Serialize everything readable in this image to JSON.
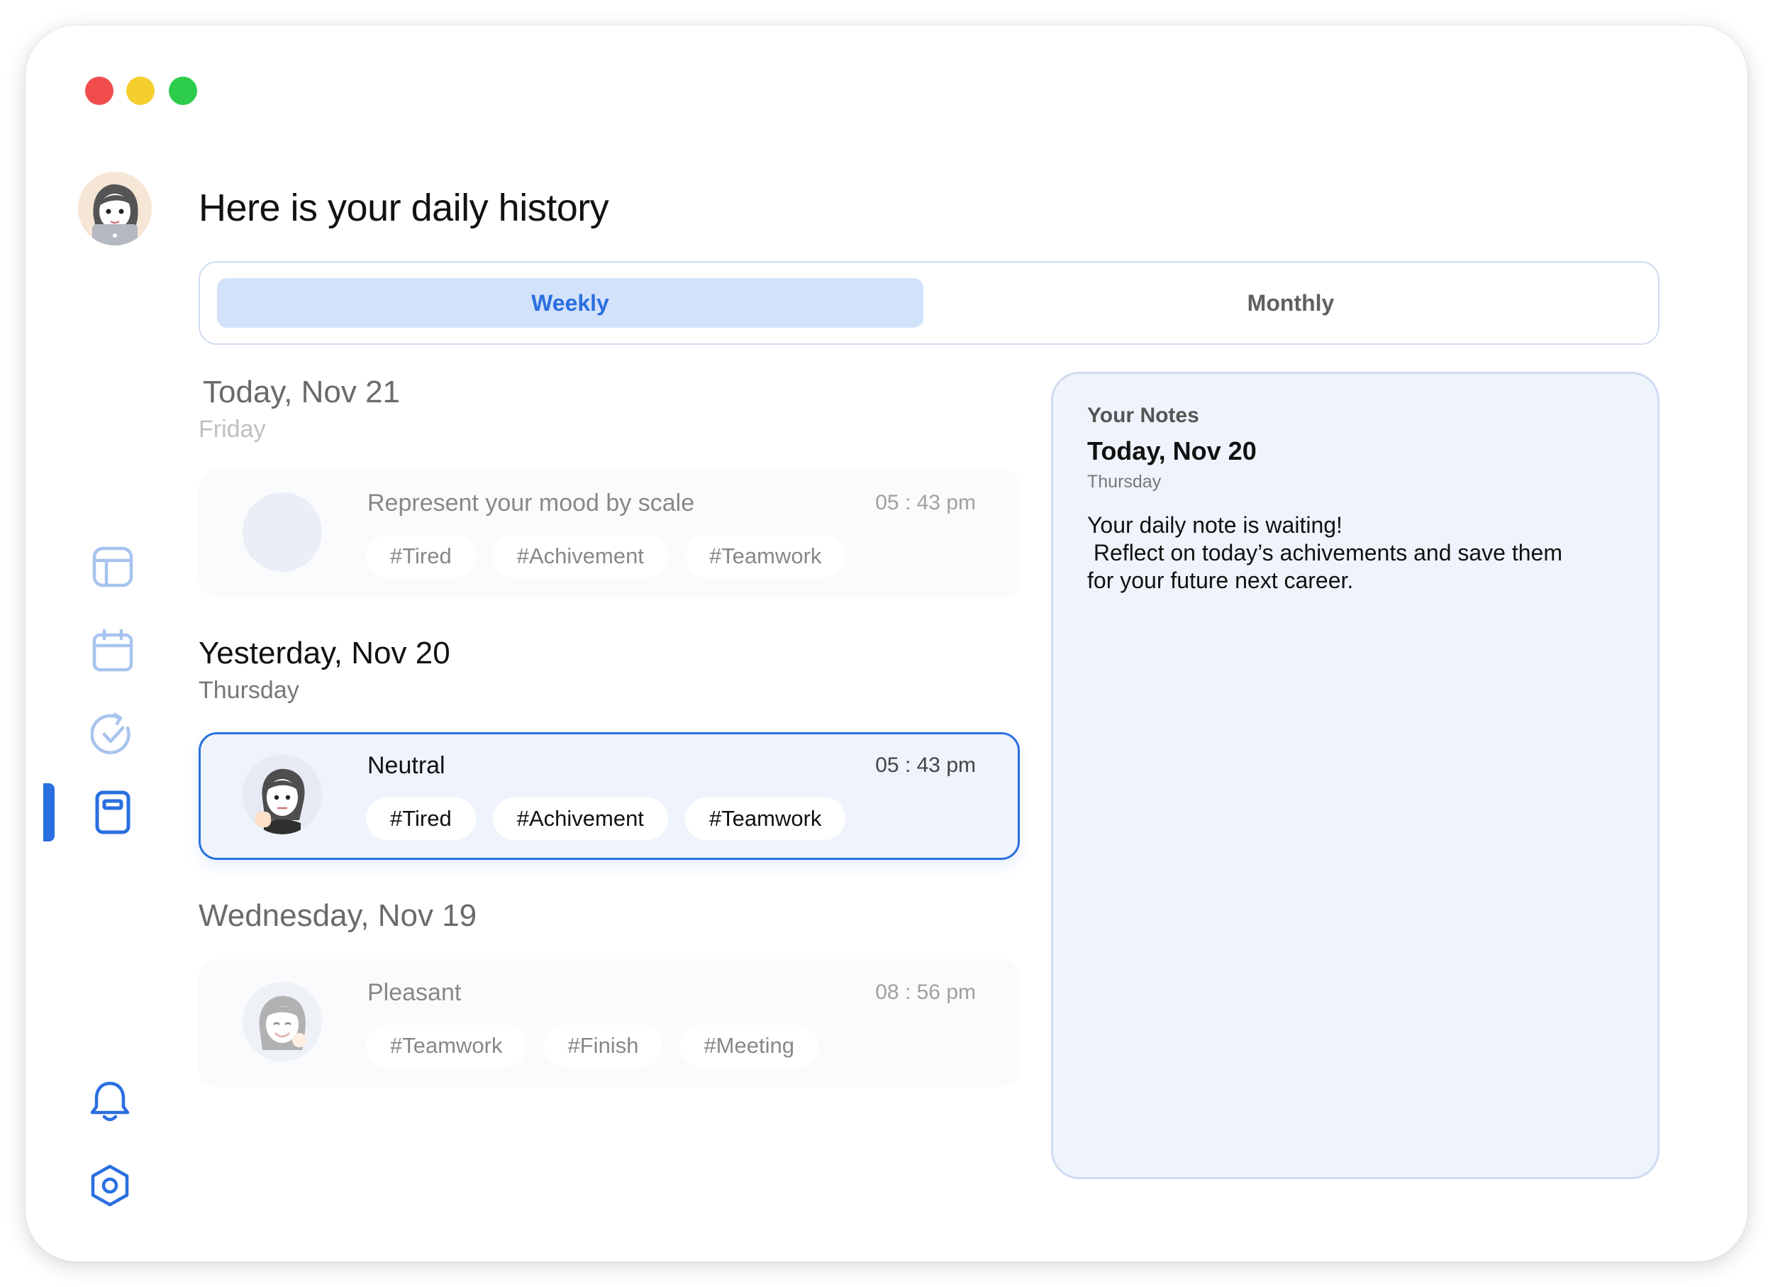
{
  "header": {
    "title": "Here is your daily history"
  },
  "tabs": [
    {
      "label": "Weekly",
      "active": true
    },
    {
      "label": "Monthly",
      "active": false
    }
  ],
  "days": [
    {
      "title": "Today, Nov 21",
      "subtitle": "Friday",
      "entry": {
        "mood": "Represent your mood by scale",
        "time": "05 : 43 pm",
        "tags": [
          "#Tired",
          "#Achivement",
          "#Teamwork"
        ]
      }
    },
    {
      "title": "Yesterday, Nov 20",
      "subtitle": "Thursday",
      "entry": {
        "mood": "Neutral",
        "time": "05 : 43 pm",
        "tags": [
          "#Tired",
          "#Achivement",
          "#Teamwork"
        ]
      }
    },
    {
      "title": "Wednesday, Nov 19",
      "entry": {
        "mood": "Pleasant",
        "time": "08 : 56 pm",
        "tags": [
          "#Teamwork",
          "#Finish",
          "#Meeting"
        ]
      }
    }
  ],
  "notes": {
    "label": "Your Notes",
    "date": "Today, Nov 20",
    "day": "Thursday",
    "lines": [
      "Your daily note is waiting!",
      " Reflect on today’s achivements and save them",
      "for your future next career."
    ]
  },
  "sidebar": [
    "dashboard-icon",
    "calendar-icon",
    "task-check-icon",
    "journal-icon",
    "bell-icon",
    "settings-icon"
  ],
  "colors": {
    "accent": "#2a6fe0",
    "active_tab_bg": "#d2e2fb",
    "notes_bg": "#eff4fc",
    "border": "#cfdbf1"
  }
}
